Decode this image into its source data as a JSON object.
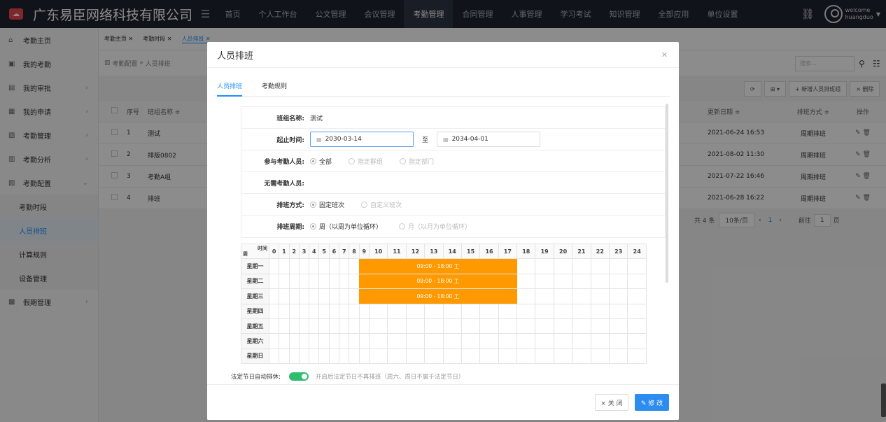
{
  "topbar": {
    "brand": "广东易臣网络科技有限公司",
    "nav": [
      "首页",
      "个人工作台",
      "公文管理",
      "会议管理",
      "考勤管理",
      "合同管理",
      "人事管理",
      "学习考试",
      "知识管理",
      "全部应用",
      "单位设置"
    ],
    "active_nav": "考勤管理",
    "user_greeting": "welcome",
    "username": "huangduo"
  },
  "sidebar": {
    "items": [
      {
        "label": "考勤主页",
        "icon": "home-icon"
      },
      {
        "label": "我的考勤",
        "icon": "calendar-icon"
      },
      {
        "label": "我的审批",
        "icon": "approve-icon"
      },
      {
        "label": "我的申请",
        "icon": "apply-icon"
      },
      {
        "label": "考勤管理",
        "icon": "manage-icon"
      },
      {
        "label": "考勤分析",
        "icon": "chart-icon"
      },
      {
        "label": "考勤配置",
        "icon": "config-icon"
      }
    ],
    "sub_items": [
      "考勤时段",
      "人员排班",
      "计算规则",
      "设备管理"
    ],
    "last_item": "假期管理"
  },
  "main": {
    "tabs": [
      "考勤主页",
      "考勤时段",
      "人员排班"
    ],
    "breadcrumb": [
      "考勤配置",
      "人员排班"
    ],
    "search_placeholder": "搜索...",
    "toolbar": {
      "refresh": "⟳",
      "grid": "⊞ ▾",
      "add": "+ 新增人员排班组",
      "delete": "× 删除"
    },
    "table_headers": {
      "no": "序号",
      "name": "班组名称 ≑",
      "date": "更新日期 ≑",
      "mode": "排班方式 ≑",
      "op": "操作"
    },
    "rows": [
      {
        "no": "1",
        "name": "测试",
        "date": "2021-06-24 16:53",
        "mode": "周期排班"
      },
      {
        "no": "2",
        "name": "排版0802",
        "date": "2021-08-02 11:30",
        "mode": "周期排班"
      },
      {
        "no": "3",
        "name": "考勤A组",
        "date": "2021-07-22 16:46",
        "mode": "周期排班"
      },
      {
        "no": "4",
        "name": "排班",
        "date": "2021-06-28 16:22",
        "mode": "周期排班"
      }
    ],
    "pager": {
      "total": "共 4 条",
      "size": "10条/页",
      "current": "1",
      "goto": "前往",
      "page": "1",
      "unit": "页"
    }
  },
  "modal": {
    "title": "人员排班",
    "tabs": [
      "人员排班",
      "考勤规则"
    ],
    "form": {
      "group_name_label": "班组名称:",
      "group_name": "测试",
      "period_label": "起止时间:",
      "start": "2030-03-14",
      "to": "至",
      "end": "2034-04-01",
      "participants_label": "参与考勤人员:",
      "participants_opts": [
        "全部",
        "指定群组",
        "指定部门"
      ],
      "exempt_label": "无需考勤人员:",
      "mode_label": "排班方式:",
      "mode_opts": [
        "固定班次",
        "自定义班次"
      ],
      "cycle_label": "排班周期:",
      "cycle_opts": [
        "周（以周为单位循环）",
        "月（以月为单位循环）"
      ]
    },
    "schedule": {
      "corner_time": "时间",
      "corner_week": "周",
      "hours": [
        "0",
        "1",
        "2",
        "3",
        "4",
        "5",
        "6",
        "7",
        "8",
        "9",
        "10",
        "11",
        "12",
        "13",
        "14",
        "15",
        "16",
        "17",
        "18",
        "19",
        "20",
        "21",
        "22",
        "23",
        "24"
      ],
      "days": [
        "星期一",
        "星期二",
        "星期三",
        "星期四",
        "星期五",
        "星期六",
        "星期日"
      ],
      "shift_label": "09:00 - 18:00 工",
      "shift_days": [
        0,
        1,
        2
      ],
      "shift_start_hour": 9,
      "shift_end_hour": 18,
      "shift_color": "#ff9900"
    },
    "holiday_label": "法定节日自动排休:",
    "holiday_hint": "开启后法定节日不再排班（周六、周日不属于法定节日）",
    "btn_close": "× 关 闭",
    "btn_edit": "✎ 修 改"
  }
}
